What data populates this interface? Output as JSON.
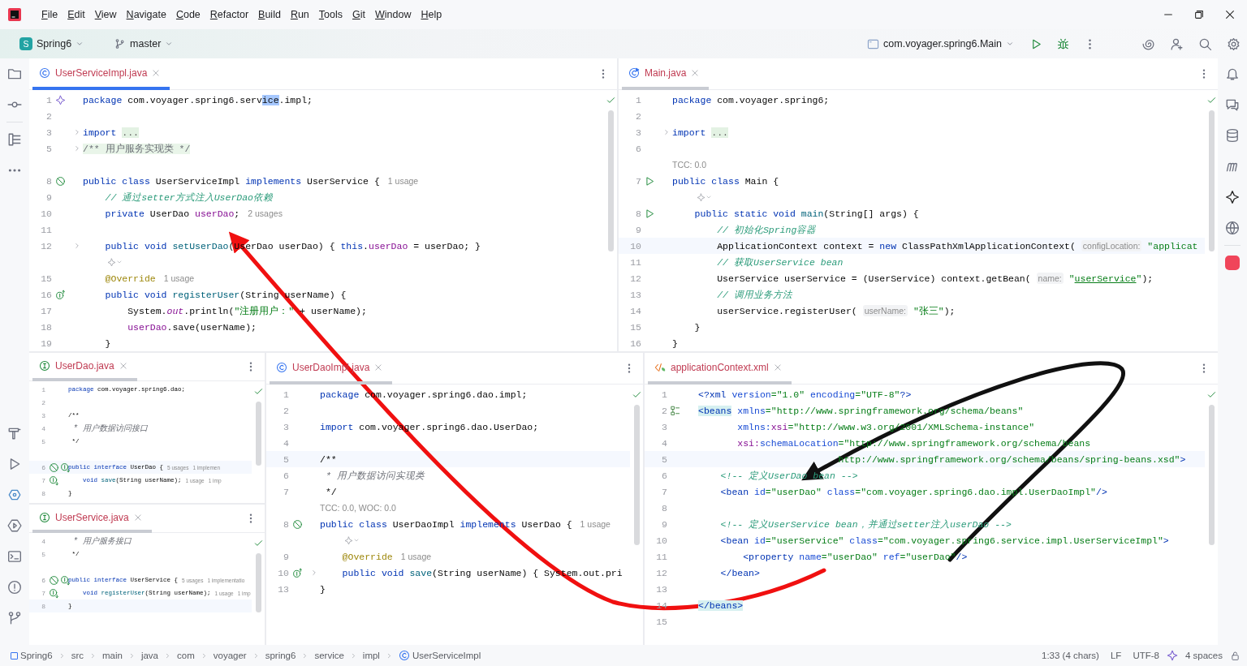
{
  "menu": [
    "File",
    "Edit",
    "View",
    "Navigate",
    "Code",
    "Refactor",
    "Build",
    "Run",
    "Tools",
    "Git",
    "Window",
    "Help"
  ],
  "toolbar": {
    "project_badge": "S",
    "project": "Spring6",
    "branch": "master",
    "run_config": "com.voyager.spring6.Main"
  },
  "editors": [
    {
      "tab": {
        "title": "UserServiceImpl.java",
        "kind": "class",
        "selected": true
      },
      "lines": [
        {
          "kind": "code",
          "n": "1",
          "gutter": [
            {
              "kind": "bean"
            }
          ],
          "code": [
            {
              "kind": "k",
              "text": "package"
            },
            {
              "kind": "p",
              "text": " com.voyager.spring6.serv"
            },
            {
              "kind": "sel",
              "text": "ice"
            },
            {
              "kind": "p",
              "text": ".impl;"
            }
          ]
        },
        {
          "kind": "code",
          "n": "2"
        },
        {
          "kind": "code",
          "n": "3",
          "folded": true,
          "code": [
            {
              "kind": "k",
              "text": "import "
            },
            {
              "kind": "fold",
              "text": "..."
            }
          ]
        },
        {
          "kind": "code",
          "n": "5",
          "folded": true,
          "code": [
            {
              "kind": "docfold",
              "text": "/** 用户服务实现类 */"
            }
          ]
        },
        {
          "kind": "gap"
        },
        {
          "kind": "code",
          "n": "8",
          "gutter": [
            {
              "kind": "no-entry"
            }
          ],
          "code": [
            {
              "kind": "k",
              "text": "public class "
            },
            {
              "kind": "p",
              "text": "UserServiceImpl "
            },
            {
              "kind": "k",
              "text": "implements "
            },
            {
              "kind": "p",
              "text": "UserService {"
            }
          ],
          "hints": [
            "1 usage"
          ]
        },
        {
          "kind": "code",
          "n": "9",
          "code": [
            {
              "kind": "c",
              "text": "    // 通过setter方式注入UserDao依赖"
            }
          ]
        },
        {
          "kind": "code",
          "n": "10",
          "code": [
            {
              "kind": "k",
              "text": "    private "
            },
            {
              "kind": "p",
              "text": "UserDao "
            },
            {
              "kind": "f",
              "text": "userDao"
            },
            {
              "kind": "p",
              "text": ";"
            }
          ],
          "hints": [
            "2 usages"
          ]
        },
        {
          "kind": "code",
          "n": "11"
        },
        {
          "kind": "code",
          "n": "12",
          "folded": true,
          "code": [
            {
              "kind": "k",
              "text": "    public void "
            },
            {
              "kind": "m",
              "text": "setUserDao"
            },
            {
              "kind": "p",
              "text": "(UserDao userDao) { "
            },
            {
              "kind": "k",
              "text": "this"
            },
            {
              "kind": "p",
              "text": "."
            },
            {
              "kind": "f",
              "text": "userDao"
            },
            {
              "kind": "p",
              "text": " = userDao; }"
            }
          ]
        },
        {
          "kind": "hint-icon"
        },
        {
          "kind": "code",
          "n": "15",
          "code": [
            {
              "kind": "a",
              "text": "    @Override"
            }
          ],
          "hints": [
            "1 usage"
          ]
        },
        {
          "kind": "code",
          "n": "16",
          "gutter": [
            {
              "kind": "impl-up"
            }
          ],
          "code": [
            {
              "kind": "k",
              "text": "    public void "
            },
            {
              "kind": "m",
              "text": "registerUser"
            },
            {
              "kind": "p",
              "text": "(String userName) {"
            }
          ]
        },
        {
          "kind": "code",
          "n": "17",
          "code": [
            {
              "kind": "p",
              "text": "        System."
            },
            {
              "kind": "it",
              "text": "out"
            },
            {
              "kind": "p",
              "text": ".println("
            },
            {
              "kind": "s",
              "text": "\"注册用户：\""
            },
            {
              "kind": "p",
              "text": " + userName);"
            }
          ]
        },
        {
          "kind": "code",
          "n": "18",
          "code": [
            {
              "kind": "f",
              "text": "        userDao"
            },
            {
              "kind": "p",
              "text": ".save(userName);"
            }
          ]
        },
        {
          "kind": "code",
          "n": "19",
          "code": [
            {
              "kind": "p",
              "text": "    }"
            }
          ]
        }
      ]
    },
    {
      "tab": {
        "title": "Main.java",
        "kind": "main",
        "selected": false
      },
      "lines": [
        {
          "kind": "code",
          "n": "1",
          "code": [
            {
              "kind": "k",
              "text": "package "
            },
            {
              "kind": "p",
              "text": "com.voyager.spring6;"
            }
          ]
        },
        {
          "kind": "code",
          "n": "2"
        },
        {
          "kind": "code",
          "n": "3",
          "folded": true,
          "code": [
            {
              "kind": "k",
              "text": "import "
            },
            {
              "kind": "fold",
              "text": "..."
            }
          ]
        },
        {
          "kind": "code",
          "n": "6"
        },
        {
          "kind": "inlay",
          "text": "TCC: 0.0"
        },
        {
          "kind": "code",
          "n": "7",
          "gutter": [
            {
              "kind": "run"
            }
          ],
          "code": [
            {
              "kind": "k",
              "text": "public class "
            },
            {
              "kind": "p",
              "text": "Main {"
            }
          ]
        },
        {
          "kind": "hint-icon"
        },
        {
          "kind": "code",
          "n": "8",
          "gutter": [
            {
              "kind": "run"
            }
          ],
          "code": [
            {
              "kind": "k",
              "text": "    public static void "
            },
            {
              "kind": "m",
              "text": "main"
            },
            {
              "kind": "p",
              "text": "(String[] args) {"
            }
          ]
        },
        {
          "kind": "code",
          "n": "9",
          "code": [
            {
              "kind": "c",
              "text": "        // 初始化Spring容器"
            }
          ]
        },
        {
          "kind": "code",
          "n": "10",
          "current": true,
          "code": [
            {
              "kind": "p",
              "text": "        ApplicationContext context = "
            },
            {
              "kind": "k",
              "text": "new "
            },
            {
              "kind": "p",
              "text": "ClassPathXmlApplicationContext( "
            },
            {
              "kind": "h",
              "text": "configLocation:"
            },
            {
              "kind": "s",
              "text": " \"applicat"
            }
          ]
        },
        {
          "kind": "code",
          "n": "11",
          "code": [
            {
              "kind": "c",
              "text": "        // 获取UserService bean"
            }
          ]
        },
        {
          "kind": "code",
          "n": "12",
          "code": [
            {
              "kind": "p",
              "text": "        UserService userService = (UserService) context.getBean( "
            },
            {
              "kind": "h",
              "text": "name:"
            },
            {
              "kind": "s",
              "text": " \""
            },
            {
              "kind": "link",
              "text": "userService"
            },
            {
              "kind": "s",
              "text": "\""
            },
            {
              "kind": "p",
              "text": ");"
            }
          ]
        },
        {
          "kind": "code",
          "n": "13",
          "code": [
            {
              "kind": "c",
              "text": "        // 调用业务方法"
            }
          ]
        },
        {
          "kind": "code",
          "n": "14",
          "code": [
            {
              "kind": "p",
              "text": "        userService.registerUser( "
            },
            {
              "kind": "h",
              "text": "userName:"
            },
            {
              "kind": "s",
              "text": " \"张三\""
            },
            {
              "kind": "p",
              "text": ");"
            }
          ]
        },
        {
          "kind": "code",
          "n": "15",
          "code": [
            {
              "kind": "p",
              "text": "    }"
            }
          ]
        },
        {
          "kind": "code",
          "n": "16",
          "code": [
            {
              "kind": "p",
              "text": "}"
            }
          ]
        }
      ]
    },
    {
      "tab": {
        "title": "UserDao.java",
        "kind": "interface",
        "selected": false
      },
      "lines": [
        {
          "kind": "code",
          "n": "1",
          "code": [
            {
              "kind": "k",
              "text": "package "
            },
            {
              "kind": "p",
              "text": "com.voyager.spring6.dao;"
            }
          ]
        },
        {
          "kind": "code",
          "n": "2"
        },
        {
          "kind": "code",
          "n": "3",
          "code": [
            {
              "kind": "p",
              "text": "/**"
            }
          ]
        },
        {
          "kind": "code",
          "n": "4",
          "code": [
            {
              "kind": "doc",
              "text": " * 用户数据访问接口"
            }
          ]
        },
        {
          "kind": "code",
          "n": "5",
          "code": [
            {
              "kind": "p",
              "text": " */"
            }
          ]
        },
        {
          "kind": "gap"
        },
        {
          "kind": "code",
          "n": "6",
          "current": true,
          "gutter": [
            {
              "kind": "no-entry"
            },
            {
              "kind": "impl-down"
            }
          ],
          "code": [
            {
              "kind": "k",
              "text": "public interface "
            },
            {
              "kind": "p",
              "text": "UserDao {"
            }
          ],
          "hints": [
            "5 usages",
            "1 implemen"
          ]
        },
        {
          "kind": "code",
          "n": "7",
          "gutter": [
            {
              "kind": "impl-down"
            }
          ],
          "code": [
            {
              "kind": "k",
              "text": "    void "
            },
            {
              "kind": "m",
              "text": "save"
            },
            {
              "kind": "p",
              "text": "(String userName);"
            }
          ],
          "hints": [
            "1 usage",
            "1 imp"
          ]
        },
        {
          "kind": "code",
          "n": "8",
          "code": [
            {
              "kind": "p",
              "text": "}"
            }
          ]
        }
      ]
    },
    {
      "tab": {
        "title": "UserService.java",
        "kind": "interface",
        "selected": false
      },
      "lines": [
        {
          "kind": "code",
          "n": "4",
          "code": [
            {
              "kind": "doc",
              "text": " * 用户服务接口"
            }
          ]
        },
        {
          "kind": "code",
          "n": "5",
          "code": [
            {
              "kind": "p",
              "text": " */"
            }
          ]
        },
        {
          "kind": "gap"
        },
        {
          "kind": "code",
          "n": "6",
          "gutter": [
            {
              "kind": "no-entry"
            },
            {
              "kind": "impl-down"
            }
          ],
          "code": [
            {
              "kind": "k",
              "text": "public interface "
            },
            {
              "kind": "p",
              "text": "UserService {"
            }
          ],
          "hints": [
            "5 usages",
            "1 implementatio"
          ]
        },
        {
          "kind": "code",
          "n": "7",
          "gutter": [
            {
              "kind": "impl-down"
            }
          ],
          "code": [
            {
              "kind": "k",
              "text": "    void "
            },
            {
              "kind": "m",
              "text": "registerUser"
            },
            {
              "kind": "p",
              "text": "(String userName);"
            }
          ],
          "hints": [
            "1 usage",
            "1 imp"
          ]
        },
        {
          "kind": "code",
          "n": "8",
          "current": true,
          "code": [
            {
              "kind": "p",
              "text": "}"
            }
          ]
        }
      ]
    },
    {
      "tab": {
        "title": "UserDaoImpl.java",
        "kind": "class",
        "selected": false
      },
      "lines": [
        {
          "kind": "code",
          "n": "1",
          "code": [
            {
              "kind": "k",
              "text": "package "
            },
            {
              "kind": "p",
              "text": "com.voyager.spring6.dao.impl;"
            }
          ]
        },
        {
          "kind": "code",
          "n": "2"
        },
        {
          "kind": "code",
          "n": "3",
          "code": [
            {
              "kind": "k",
              "text": "import "
            },
            {
              "kind": "p",
              "text": "com.voyager.spring6.dao.UserDao;"
            }
          ]
        },
        {
          "kind": "code",
          "n": "4"
        },
        {
          "kind": "code",
          "n": "5",
          "current": true,
          "code": [
            {
              "kind": "p",
              "text": "/**"
            }
          ]
        },
        {
          "kind": "code",
          "n": "6",
          "code": [
            {
              "kind": "doc",
              "text": " * 用户数据访问实现类"
            }
          ]
        },
        {
          "kind": "code",
          "n": "7",
          "code": [
            {
              "kind": "p",
              "text": " */"
            }
          ]
        },
        {
          "kind": "inlay",
          "text": "TCC: 0.0, WOC: 0.0"
        },
        {
          "kind": "code",
          "n": "8",
          "gutter": [
            {
              "kind": "no-entry"
            }
          ],
          "code": [
            {
              "kind": "k",
              "text": "public class "
            },
            {
              "kind": "p",
              "text": "UserDaoImpl "
            },
            {
              "kind": "k",
              "text": "implements "
            },
            {
              "kind": "p",
              "text": "UserDao {"
            }
          ],
          "hints": [
            "1 usage"
          ]
        },
        {
          "kind": "hint-icon"
        },
        {
          "kind": "code",
          "n": "9",
          "code": [
            {
              "kind": "a",
              "text": "    @Override"
            }
          ],
          "hints": [
            "1 usage"
          ]
        },
        {
          "kind": "code",
          "n": "10",
          "gutter": [
            {
              "kind": "impl-up"
            }
          ],
          "folded": true,
          "code": [
            {
              "kind": "k",
              "text": "    public void "
            },
            {
              "kind": "m",
              "text": "save"
            },
            {
              "kind": "p",
              "text": "(String userName) { System.out.pri"
            }
          ]
        },
        {
          "kind": "code",
          "n": "13",
          "code": [
            {
              "kind": "p",
              "text": "}"
            }
          ]
        }
      ]
    },
    {
      "tab": {
        "title": "applicationContext.xml",
        "kind": "xml",
        "selected": false
      },
      "lines": [
        {
          "kind": "code",
          "n": "1",
          "code": [
            {
              "kind": "t",
              "text": "<?xml "
            },
            {
              "kind": "at",
              "text": "version"
            },
            {
              "kind": "s",
              "text": "=\"1.0\" "
            },
            {
              "kind": "at",
              "text": "encoding"
            },
            {
              "kind": "s",
              "text": "=\"UTF-8\""
            },
            {
              "kind": "t",
              "text": "?>"
            }
          ]
        },
        {
          "kind": "code",
          "n": "2",
          "gutter": [
            {
              "kind": "xml-bean"
            }
          ],
          "code": [
            {
              "kind": "th",
              "text": "<beans"
            },
            {
              "kind": "at",
              "text": " xmlns"
            },
            {
              "kind": "s",
              "text": "=\"http://www.springframework.org/schema/beans\""
            }
          ]
        },
        {
          "kind": "code",
          "n": "3",
          "code": [
            {
              "kind": "at",
              "text": "       xmlns:"
            },
            {
              "kind": "ns",
              "text": "xsi"
            },
            {
              "kind": "s",
              "text": "=\"http://www.w3.org/2001/XMLSchema-instance\""
            }
          ]
        },
        {
          "kind": "code",
          "n": "4",
          "code": [
            {
              "kind": "ns",
              "text": "       xsi:"
            },
            {
              "kind": "at",
              "text": "schemaLocation"
            },
            {
              "kind": "s",
              "text": "=\"http://www.springframework.org/schema/beans"
            }
          ]
        },
        {
          "kind": "code",
          "n": "5",
          "current": true,
          "code": [
            {
              "kind": "s",
              "text": "                         http://www.springframework.org/schema/beans/spring-beans.xsd\""
            },
            {
              "kind": "t",
              "text": ">"
            }
          ]
        },
        {
          "kind": "code",
          "n": "6",
          "code": [
            {
              "kind": "c",
              "text": "    <!-- 定义UserDao bean -->"
            }
          ]
        },
        {
          "kind": "code",
          "n": "7",
          "code": [
            {
              "kind": "t",
              "text": "    <bean "
            },
            {
              "kind": "at",
              "text": "id"
            },
            {
              "kind": "s",
              "text": "=\"userDao\" "
            },
            {
              "kind": "at",
              "text": "class"
            },
            {
              "kind": "s",
              "text": "=\"com.voyager.spring6.dao.impl.UserDaoImpl\""
            },
            {
              "kind": "t",
              "text": "/>"
            }
          ]
        },
        {
          "kind": "code",
          "n": "8"
        },
        {
          "kind": "code",
          "n": "9",
          "code": [
            {
              "kind": "c",
              "text": "    <!-- 定义UserService bean，并通过setter注入userDao -->"
            }
          ]
        },
        {
          "kind": "code",
          "n": "10",
          "code": [
            {
              "kind": "t",
              "text": "    <bean "
            },
            {
              "kind": "at",
              "text": "id"
            },
            {
              "kind": "s",
              "text": "=\"userService\" "
            },
            {
              "kind": "at",
              "text": "class"
            },
            {
              "kind": "s",
              "text": "=\"com.voyager.spring6.service.impl.UserServiceImpl\""
            },
            {
              "kind": "t",
              "text": ">"
            }
          ]
        },
        {
          "kind": "code",
          "n": "11",
          "code": [
            {
              "kind": "t",
              "text": "        <property "
            },
            {
              "kind": "at",
              "text": "name"
            },
            {
              "kind": "s",
              "text": "=\"userDao\" "
            },
            {
              "kind": "at",
              "text": "ref"
            },
            {
              "kind": "s",
              "text": "=\"userDao\""
            },
            {
              "kind": "t",
              "text": "/>"
            }
          ]
        },
        {
          "kind": "code",
          "n": "12",
          "code": [
            {
              "kind": "t",
              "text": "    </bean>"
            }
          ]
        },
        {
          "kind": "code",
          "n": "13"
        },
        {
          "kind": "code",
          "n": "14",
          "code": [
            {
              "kind": "th",
              "text": "</beans>"
            }
          ]
        },
        {
          "kind": "code",
          "n": "15"
        }
      ]
    }
  ],
  "status_bar": {
    "breadcrumbs": [
      "Spring6",
      "src",
      "main",
      "java",
      "com",
      "voyager",
      "spring6",
      "service",
      "impl",
      "UserServiceImpl"
    ],
    "position": "1:33 (4 chars)",
    "line_ending": "LF",
    "encoding": "UTF-8",
    "indent": "4 spaces"
  }
}
